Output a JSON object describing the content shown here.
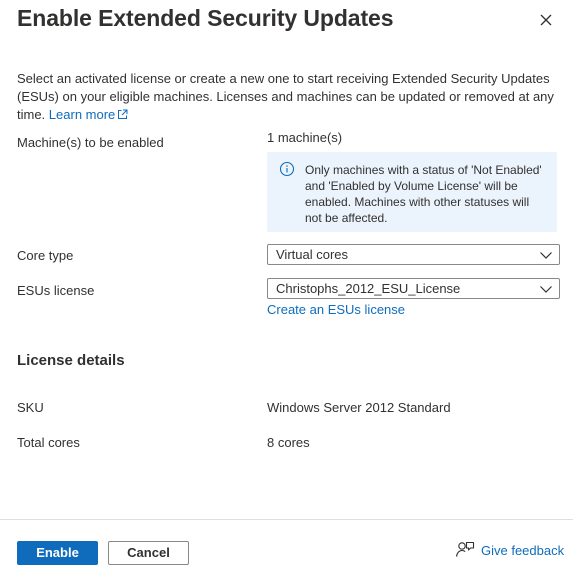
{
  "dialog": {
    "title": "Enable Extended Security Updates",
    "description": "Select an activated license or create a new one to start receiving Extended Security Updates (ESUs) on your eligible machines. Licenses and machines can be updated or removed at any time.",
    "learn_more": "Learn more"
  },
  "machines": {
    "label": "Machine(s) to be enabled",
    "value": "1 machine(s)",
    "info": "Only machines with a status of 'Not Enabled' and 'Enabled by Volume License' will be enabled. Machines with other statuses will not be affected."
  },
  "core_type": {
    "label": "Core type",
    "selected": "Virtual cores"
  },
  "esus_license": {
    "label": "ESUs license",
    "selected": "Christophs_2012_ESU_License",
    "create_link": "Create an ESUs license"
  },
  "license_details": {
    "title": "License details",
    "sku_label": "SKU",
    "sku_value": "Windows Server 2012 Standard",
    "cores_label": "Total cores",
    "cores_value": "8 cores"
  },
  "footer": {
    "enable": "Enable",
    "cancel": "Cancel",
    "feedback": "Give feedback"
  },
  "icons": {
    "close": "close-icon",
    "external": "external-link-icon",
    "info": "info-icon",
    "chevron": "chevron-down-icon",
    "feedback": "feedback-icon"
  },
  "colors": {
    "accent": "#0f6cbd",
    "info_bg": "#ebf3fc",
    "text": "#323130"
  }
}
